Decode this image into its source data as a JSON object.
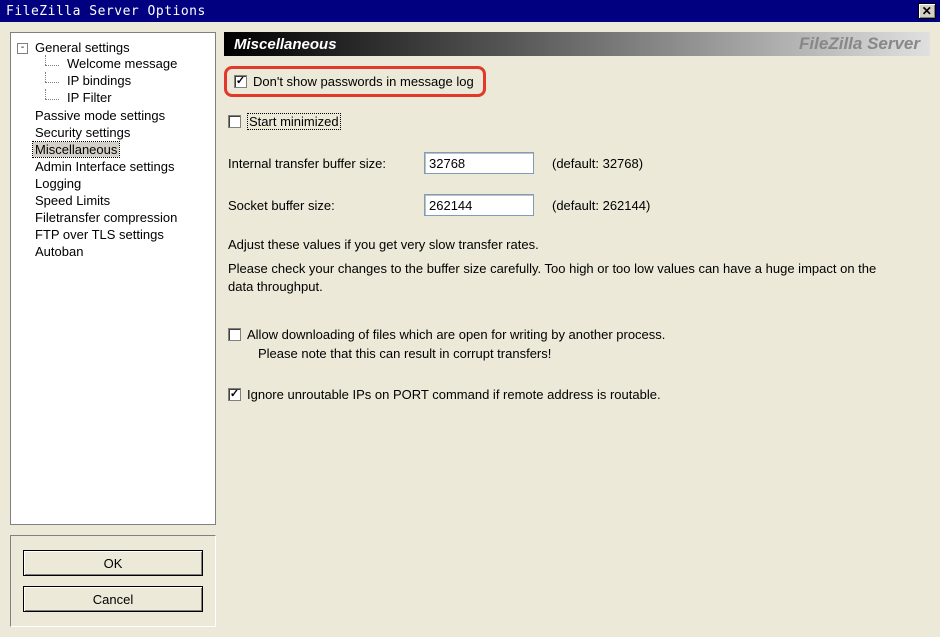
{
  "window": {
    "title": "FileZilla Server Options",
    "close_label": "✕"
  },
  "tree": {
    "root": {
      "label": "General settings",
      "expander": "-",
      "children": [
        {
          "label": "Welcome message"
        },
        {
          "label": "IP bindings"
        },
        {
          "label": "IP Filter"
        }
      ]
    },
    "items": [
      {
        "label": "Passive mode settings"
      },
      {
        "label": "Security settings"
      },
      {
        "label": "Miscellaneous",
        "selected": true
      },
      {
        "label": "Admin Interface settings"
      },
      {
        "label": "Logging"
      },
      {
        "label": "Speed Limits"
      },
      {
        "label": "Filetransfer compression"
      },
      {
        "label": "FTP over TLS settings"
      },
      {
        "label": "Autoban"
      }
    ]
  },
  "buttons": {
    "ok": "OK",
    "cancel": "Cancel"
  },
  "section": {
    "title": "Miscellaneous",
    "brand": "FileZilla Server"
  },
  "misc": {
    "dont_show_passwords": {
      "label": "Don't show passwords in message log",
      "checked": true
    },
    "start_minimized": {
      "label": "Start minimized",
      "checked": false
    },
    "internal_buffer": {
      "label": "Internal transfer buffer size:",
      "value": "32768",
      "hint": "(default: 32768)"
    },
    "socket_buffer": {
      "label": "Socket buffer size:",
      "value": "262144",
      "hint": "(default: 262144)"
    },
    "note1": "Adjust these values if you get very slow transfer rates.",
    "note2": "Please check your changes to the buffer size carefully. Too high or too low values can have a huge impact on the data throughput.",
    "allow_download_open": {
      "label": "Allow downloading of files which are open for writing by another process.",
      "note": "Please note that this can result in corrupt transfers!",
      "checked": false
    },
    "ignore_unroutable": {
      "label": "Ignore unroutable IPs on PORT command if remote address is routable.",
      "checked": true
    }
  }
}
